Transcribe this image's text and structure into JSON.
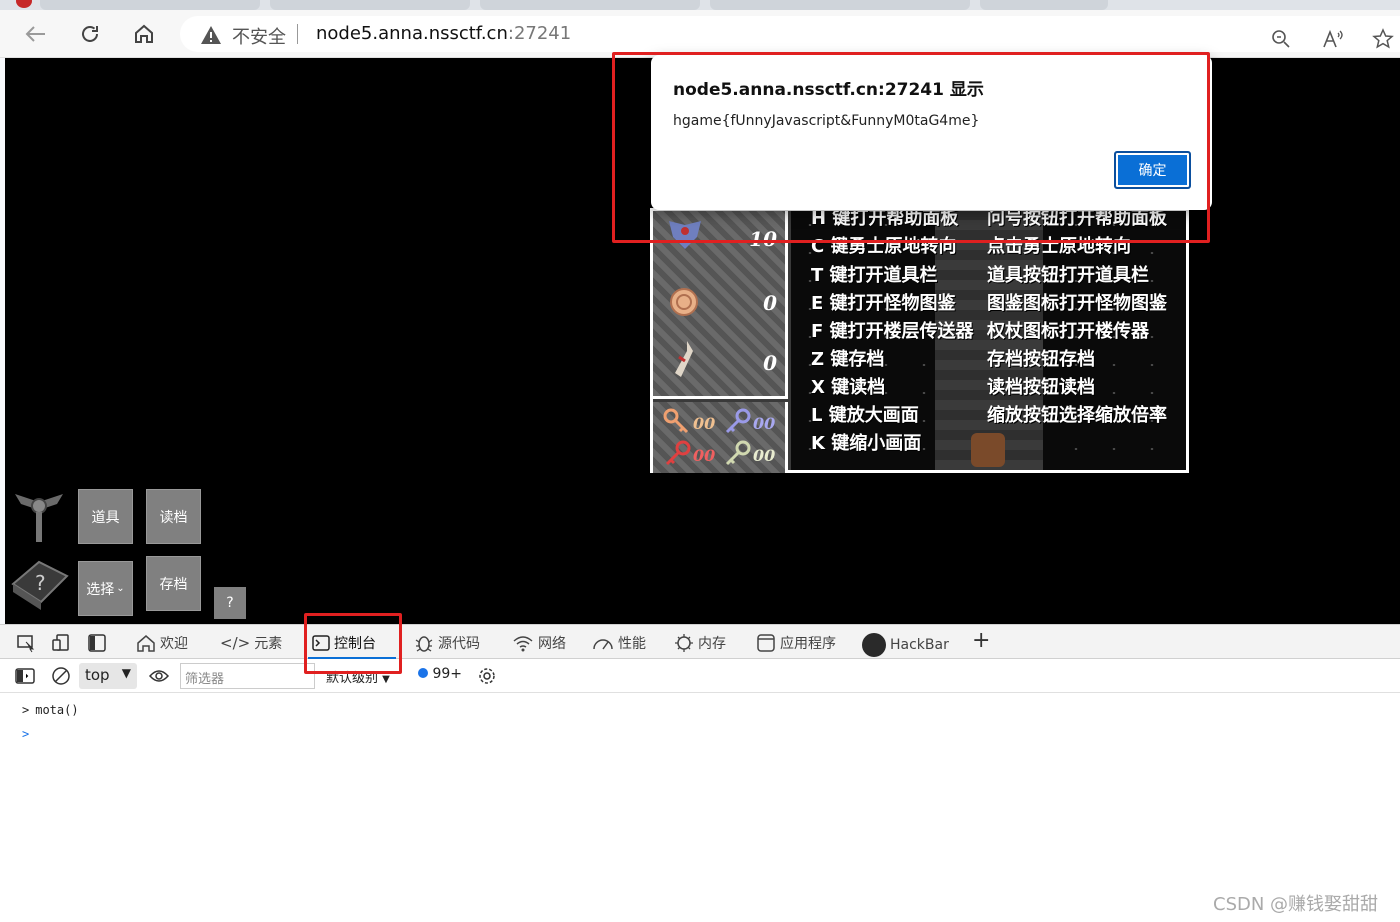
{
  "browser": {
    "address_insecure": "不安全",
    "address_host": "node5.anna.nssctf.cn",
    "address_port": ":27241"
  },
  "game": {
    "status_values": [
      "10",
      "0",
      "0"
    ],
    "key_counts": [
      "00",
      "00",
      "00",
      "00"
    ],
    "help_left": [
      "H 键打开帮助面板",
      "C 键勇士原地转向",
      "T 键打开道具栏",
      "E 键打开怪物图鉴",
      "F 键打开楼层传送器",
      "Z 键存档",
      "X 键读档",
      "L 键放大画面",
      "K 键缩小画面"
    ],
    "help_right": [
      "问号按钮打开帮助面板",
      "点击勇士原地转向",
      "道具按钮打开道具栏",
      "图鉴图标打开怪物图鉴",
      "权杖图标打开楼传器",
      "存档按钮存档",
      "读档按钮读档",
      "缩放按钮选择缩放倍率"
    ],
    "buttons": {
      "items": "道具",
      "load": "读档",
      "select": "选择",
      "save": "存档",
      "help": "?"
    }
  },
  "dialog": {
    "title": "node5.anna.nssctf.cn:27241 显示",
    "message": "hgame{fUnnyJavascript&FunnyM0taG4me}",
    "ok_label": "确定"
  },
  "devtools": {
    "tabs": [
      "欢迎",
      "元素",
      "控制台",
      "源代码",
      "网络",
      "性能",
      "内存",
      "应用程序",
      "HackBar"
    ],
    "active_tab": "控制台",
    "context": "top",
    "filter_placeholder": "筛选器",
    "level": "默认级别",
    "issues_count": "99+",
    "console_lines": [
      "mota()"
    ]
  },
  "watermark": "CSDN @赚钱娶甜甜",
  "colors": {
    "accent": "#0a6fd6",
    "highlight_box": "#e02020"
  }
}
